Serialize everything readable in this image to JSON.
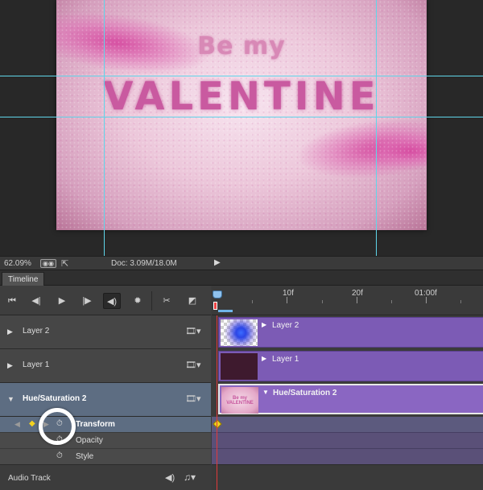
{
  "canvas": {
    "title_line1": "Be my",
    "title_line2": "VALENTINE"
  },
  "status_bar": {
    "zoom": "62.09%",
    "doc_size": "Doc: 3.09M/18.0M"
  },
  "timeline": {
    "tab_label": "Timeline",
    "controls": {
      "first_frame_icon": "skip-to-start-icon",
      "prev_frame_icon": "previous-frame-icon",
      "play_icon": "play-icon",
      "next_frame_icon": "next-frame-icon",
      "audio_icon": "speaker-icon",
      "settings_icon": "gear-icon",
      "split_icon": "scissors-icon",
      "transition_icon": "transition-icon"
    },
    "ruler": {
      "labels": [
        "10f",
        "20f",
        "01:00f"
      ]
    },
    "layers": [
      {
        "name": "Layer 2",
        "expanded": false
      },
      {
        "name": "Layer 1",
        "expanded": false
      },
      {
        "name": "Hue/Saturation 2",
        "expanded": true,
        "selected": true
      }
    ],
    "properties": [
      {
        "name": "Transform",
        "active": true,
        "has_keyframe": true
      },
      {
        "name": "Opacity",
        "active": false
      },
      {
        "name": "Style",
        "active": false
      }
    ],
    "audio_track": "Audio Track",
    "clips": [
      {
        "name": "Layer 2"
      },
      {
        "name": "Layer 1"
      },
      {
        "name": "Hue/Saturation 2",
        "thumb_text": "Be my VALENTINE"
      }
    ],
    "colors": {
      "clip": "#7c5bb5",
      "selected_row": "#5d6d82",
      "playhead": "#e03a3a",
      "keyframe": "#f0d020",
      "guide": "#5fd6ea"
    }
  }
}
